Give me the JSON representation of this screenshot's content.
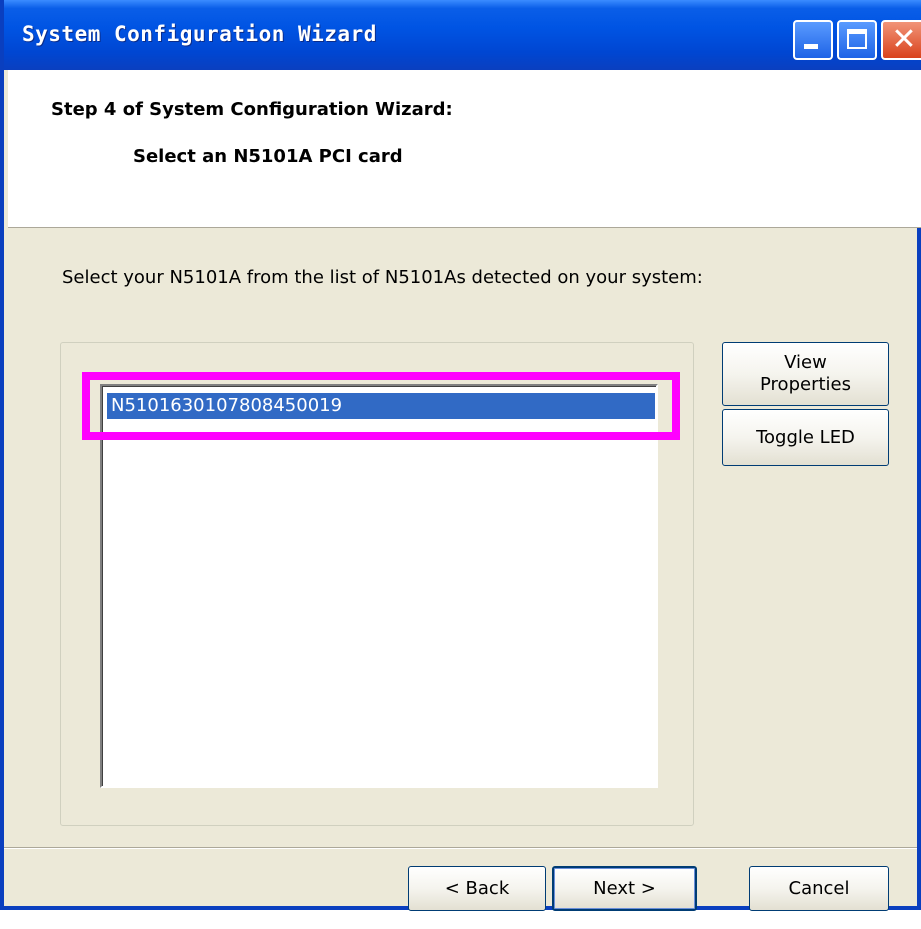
{
  "window": {
    "title": "System Configuration Wizard"
  },
  "titlebar_buttons": {
    "minimize_icon": "minimize-icon",
    "maximize_icon": "maximize-icon",
    "close_icon": "close-icon"
  },
  "header": {
    "step_title": "Step 4 of System Configuration Wizard:",
    "step_subtitle": "Select an N5101A PCI card"
  },
  "main": {
    "prompt": "Select your N5101A from the list of N5101As detected on your system:",
    "devices": [
      {
        "label": "N5101630107808450019",
        "selected": true
      }
    ],
    "highlight_color": "#ff00ff",
    "selection_color": "#316ac5"
  },
  "side_buttons": {
    "view_line1": "View",
    "view_line2": "Properties",
    "toggle_led": "Toggle LED"
  },
  "footer": {
    "back": "< Back",
    "next": "Next >",
    "cancel": "Cancel"
  }
}
